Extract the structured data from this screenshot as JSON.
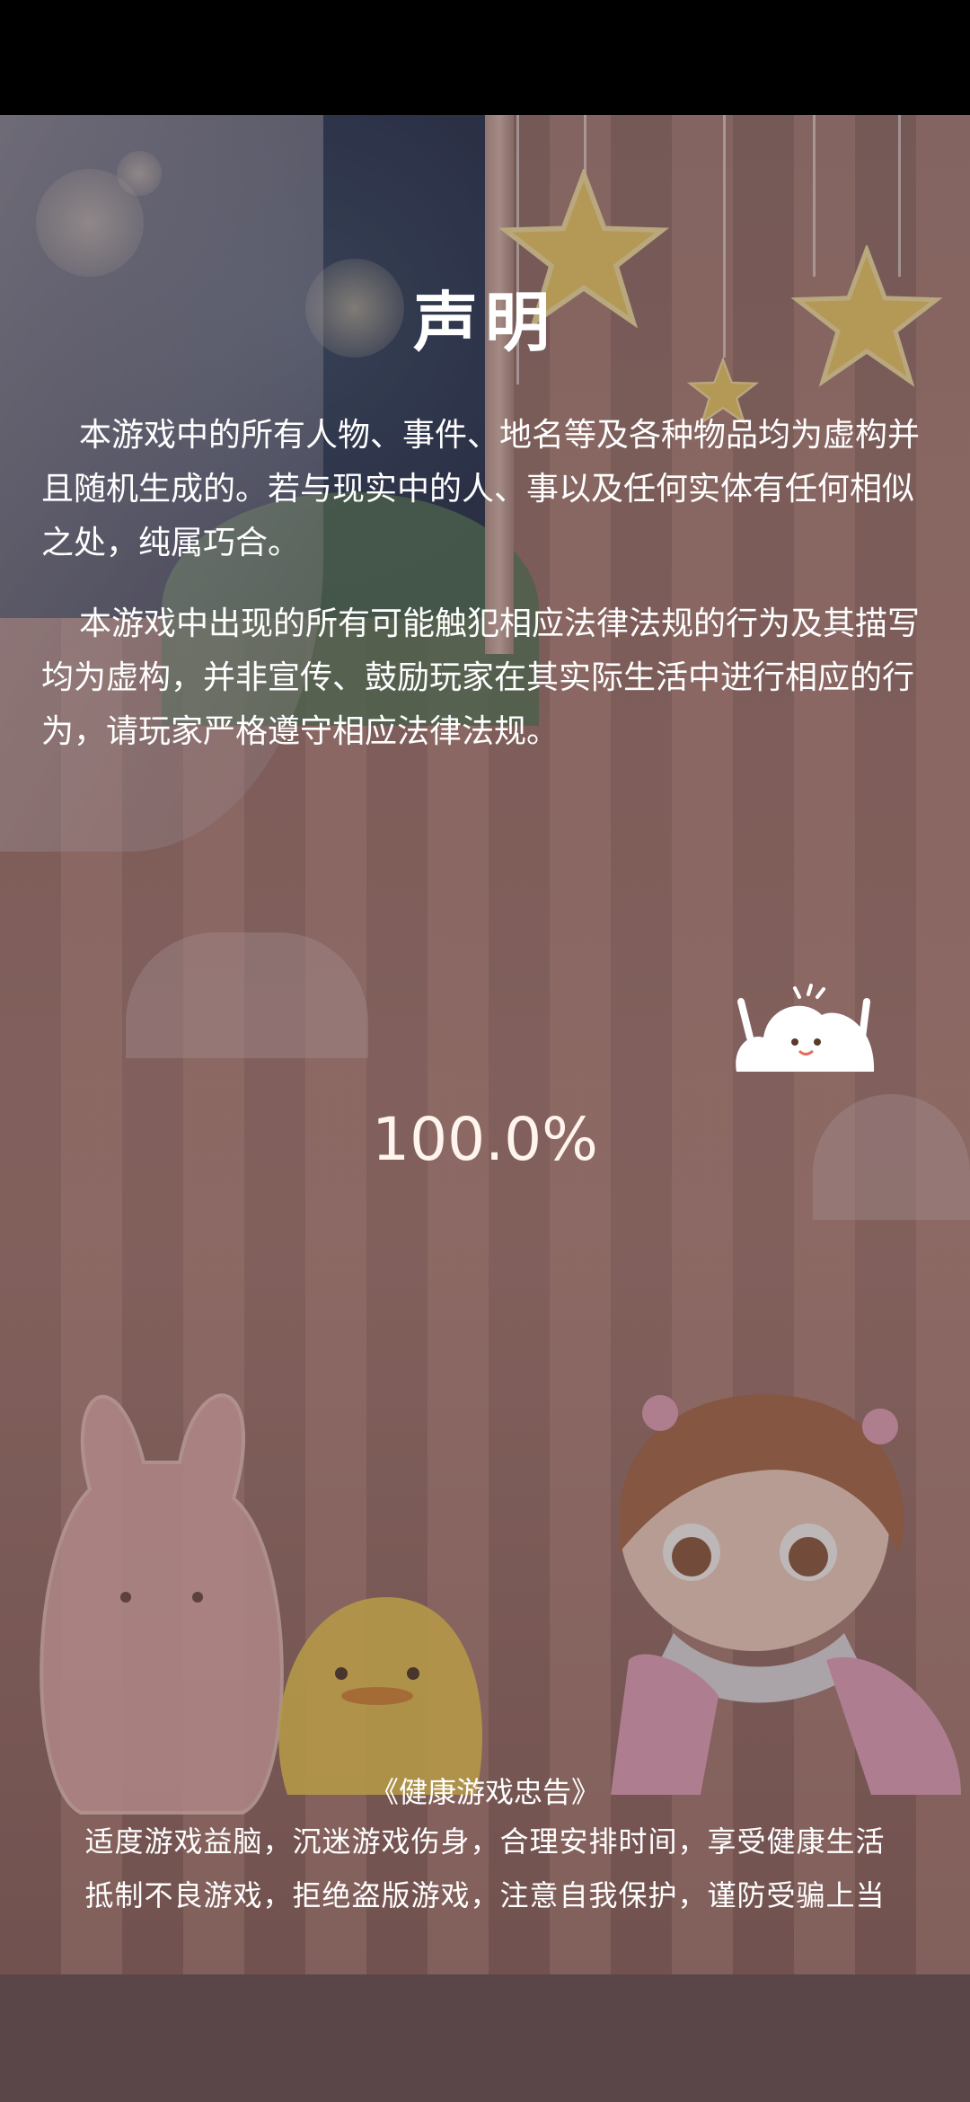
{
  "notice": {
    "title": "声明",
    "paragraphs": [
      "本游戏中的所有人物、事件、地名等及各种物品均为虚构并且随机生成的。若与现实中的人、事以及任何实体有任何相似之处，纯属巧合。",
      "本游戏中出现的所有可能触犯相应法律法规的行为及其描写均为虚构，并非宣传、鼓励玩家在其实际生活中进行相应的行为，请玩家严格遵守相应法律法规。"
    ]
  },
  "loading": {
    "progress_text": "100.0%",
    "progress": 1.0
  },
  "advice": {
    "title": "《健康游戏忠告》",
    "lines": [
      "适度游戏益脑，沉迷游戏伤身，合理安排时间，享受健康生活",
      "抵制不良游戏，拒绝盗版游戏，注意自我保护，谨防受骗上当"
    ]
  },
  "colors": {
    "text": "#ffffff",
    "background": "#9c7570"
  }
}
